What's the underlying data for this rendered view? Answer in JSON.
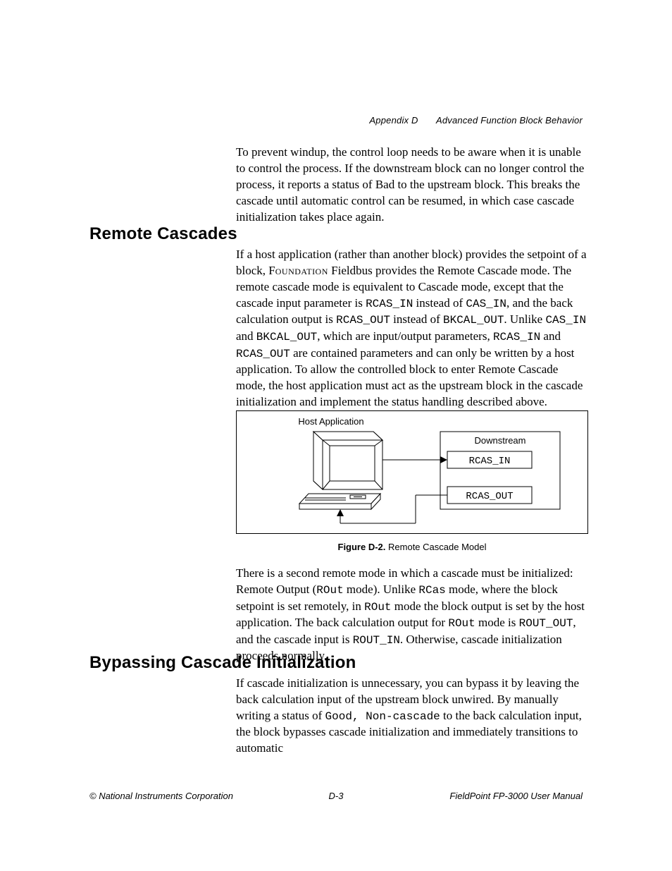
{
  "header": {
    "appendix": "Appendix D",
    "title": "Advanced Function Block Behavior"
  },
  "para1": "To prevent windup, the control loop needs to be aware when it is unable to control the process. If the downstream block can no longer control the process, it reports a status of Bad to the upstream block. This breaks the cascade until automatic control can be resumed, in which case cascade initialization takes place again.",
  "section1": {
    "heading": "Remote Cascades",
    "para_parts": {
      "t1": "If a host application (rather than another block) provides the setpoint of a block, F",
      "sc1": "oundation",
      "t2": " Fieldbus provides the Remote Cascade mode. The remote cascade mode is equivalent to Cascade mode, except that the cascade input parameter is ",
      "m1": "RCAS_IN",
      "t3": " instead of ",
      "m2": "CAS_IN",
      "t4": ", and the back calculation output is ",
      "m3": "RCAS_OUT",
      "t5": " instead of ",
      "m4": "BKCAL_OUT",
      "t6": ". Unlike ",
      "m5": "CAS_IN",
      "t7": " and ",
      "m6": "BKCAL_OUT",
      "t8": ", which are input/output parameters, ",
      "m7": "RCAS_IN",
      "t9": " and ",
      "m8": "RCAS_OUT",
      "t10": " are contained parameters and can only be written by a host application. To allow the controlled block to enter Remote Cascade mode, the host application must act as the upstream block in the cascade initialization and implement the status handling described above."
    }
  },
  "figure": {
    "host_label": "Host Application",
    "downstream": "Downstream",
    "rcas_in": "RCAS_IN",
    "rcas_out": "RCAS_OUT",
    "caption_bold": "Figure D-2.",
    "caption_rest": "  Remote Cascade Model"
  },
  "para3_parts": {
    "t1": "There is a second remote mode in which a cascade must be initialized: Remote Output (",
    "m1": "ROut",
    "t2": " mode). Unlike ",
    "m2": "RCas",
    "t3": " mode, where the block setpoint is set remotely, in ",
    "m3": "ROut",
    "t4": " mode the block output is set by the host application. The back calculation output for ",
    "m4": "ROut",
    "t5": " mode is ",
    "m5": "ROUT_OUT",
    "t6": ", and the cascade input is ",
    "m6": "ROUT_IN",
    "t7": ". Otherwise, cascade initialization proceeds normally."
  },
  "section2": {
    "heading": "Bypassing Cascade Initialization",
    "para_parts": {
      "t1": "If cascade initialization is unnecessary, you can bypass it by leaving the back calculation input of the upstream block unwired. By manually writing a status of ",
      "m1": "Good, Non-cascade",
      "t2": " to the back calculation input, the block bypasses cascade initialization and immediately transitions to automatic"
    }
  },
  "footer": {
    "left": "© National Instruments Corporation",
    "center": "D-3",
    "right": "FieldPoint FP-3000 User Manual"
  }
}
